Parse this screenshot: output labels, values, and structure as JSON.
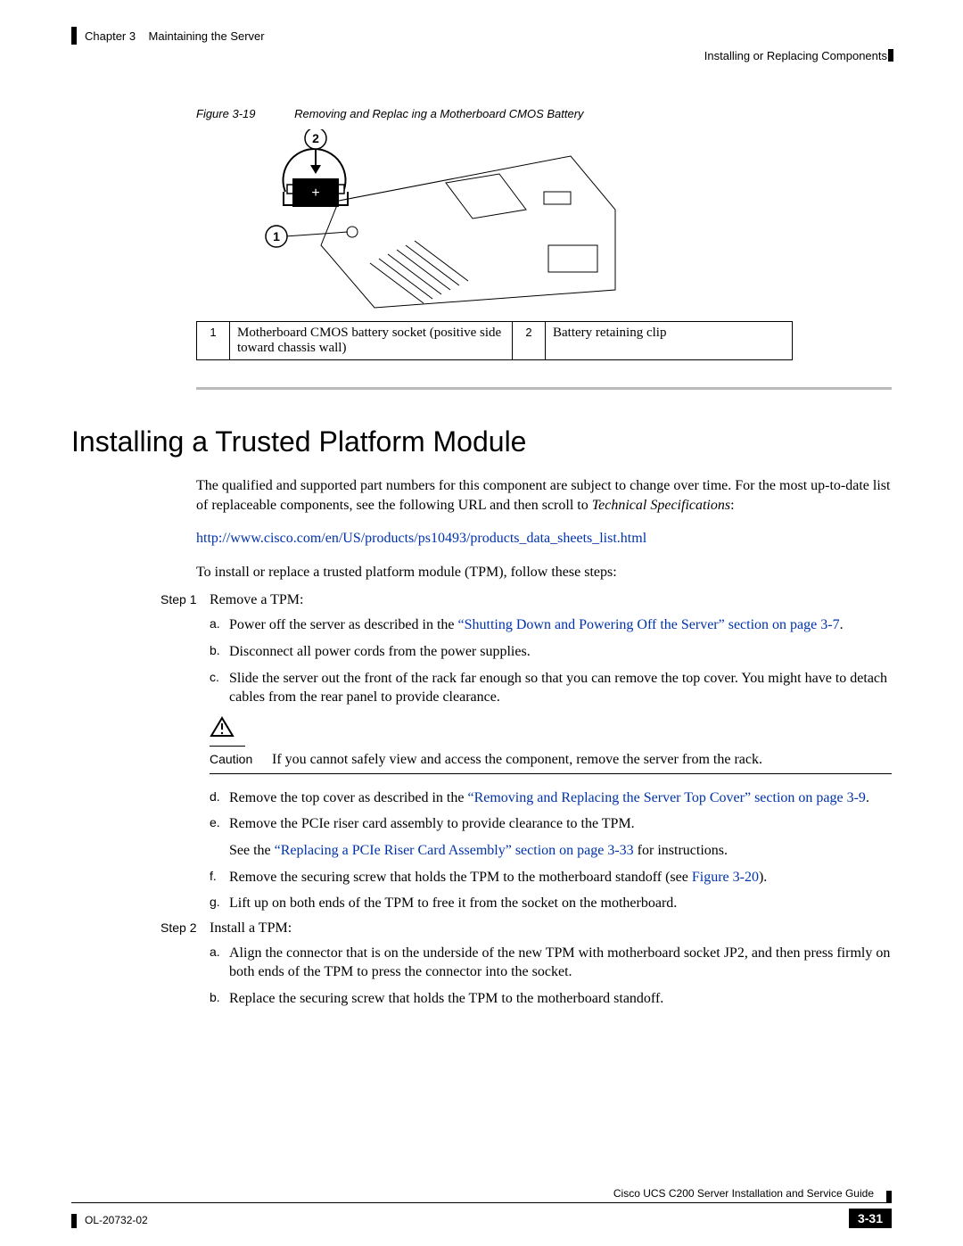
{
  "header": {
    "chapter": "Chapter 3",
    "chapter_title": "Maintaining the Server",
    "section_right": "Installing or Replacing Components"
  },
  "figure": {
    "number": "Figure 3-19",
    "title": "Removing and Replac  ing a Motherboard CMOS Battery",
    "callouts": {
      "c1": "1",
      "c2": "2",
      "plus": "+"
    }
  },
  "legend": {
    "n1": "1",
    "t1": "Motherboard CMOS battery socket (positive side toward chassis wall)",
    "n2": "2",
    "t2": "Battery retaining clip"
  },
  "heading": "Installing a Trusted Platform Module",
  "intro1a": "The qualified and supported part numbers for this component are subject to change over time. For the most up-to-date list of replaceable components, see the following URL and then scroll to ",
  "intro1b": "Technical Specifications",
  "intro1c": ":",
  "url": "http://www.cisco.com/en/US/products/ps10493/products_data_sheets_list.html",
  "intro2": "To install or replace a trusted platform module (TPM), follow these steps:",
  "steps": {
    "s1_label": "Step 1",
    "s1_text": "Remove a TPM:",
    "s2_label": "Step 2",
    "s2_text": "Install a TPM:"
  },
  "subs": {
    "a_label": "a.",
    "a_pre": "Power off the server as described in the ",
    "a_link": "“Shutting Down and Powering Off the Server” section on page 3-7",
    "a_post": ".",
    "b_label": "b.",
    "b_text": "Disconnect all power cords from the power supplies.",
    "c_label": "c.",
    "c_text": "Slide the server out the front of the rack far enough so that you can remove the top cover. You might have to detach cables from the rear panel to provide clearance.",
    "d_label": "d.",
    "d_pre": "Remove the top cover as described in the ",
    "d_link": "“Removing and Replacing the Server Top Cover” section on page 3-9",
    "d_post": ".",
    "e_label": "e.",
    "e_text": "Remove the PCIe riser card assembly to provide clearance to the TPM.",
    "e2_pre": "See the ",
    "e2_link": "“Replacing a PCIe Riser Card Assembly” section on page 3-33",
    "e2_post": " for instructions.",
    "f_label": "f.",
    "f_pre": "Remove the securing screw that holds the TPM to the motherboard standoff (see ",
    "f_link": "Figure 3-20",
    "f_post": ").",
    "g_label": "g.",
    "g_text": "Lift up on both ends of the TPM to free it from the socket on the motherboard.",
    "s2a_label": "a.",
    "s2a_text": "Align the connector that is on the underside of the new TPM with motherboard socket JP2, and then press firmly on both ends of the TPM to press the connector into the socket.",
    "s2b_label": "b.",
    "s2b_text": "Replace the securing screw that holds the TPM to the motherboard standoff."
  },
  "caution": {
    "label": "Caution",
    "text": "If you cannot safely view and access the component, remove the server from the rack."
  },
  "footer": {
    "guide": "Cisco UCS C200 Server Installation and Service Guide",
    "doc": "OL-20732-02",
    "page": "3-31"
  }
}
